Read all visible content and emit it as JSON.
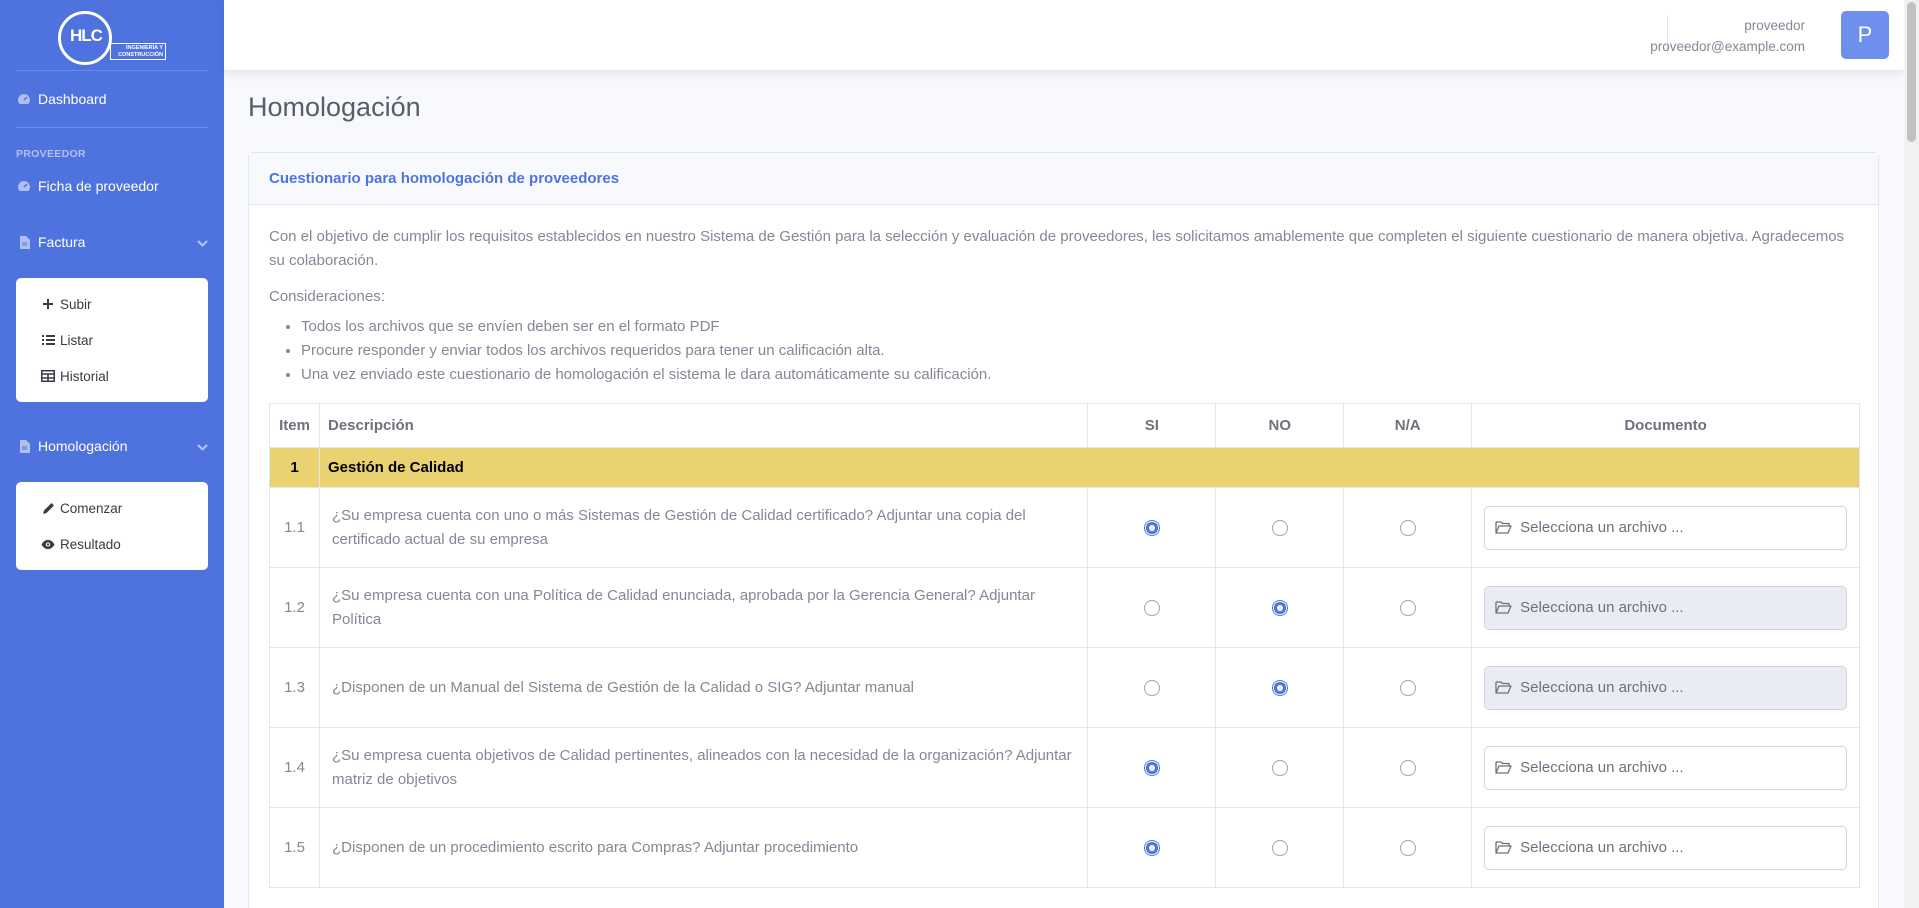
{
  "sidebar": {
    "logo": {
      "initials": "HLC",
      "subtitle_line1": "INGENIERÍA Y",
      "subtitle_line2": "CONSTRUCCIÓN"
    },
    "dashboard": "Dashboard",
    "section_heading": "PROVEEDOR",
    "ficha": "Ficha de proveedor",
    "factura": {
      "label": "Factura",
      "items": [
        "Subir",
        "Listar",
        "Historial"
      ]
    },
    "homologacion": {
      "label": "Homologación",
      "items": [
        "Comenzar",
        "Resultado"
      ]
    }
  },
  "topbar": {
    "user_name": "proveedor",
    "user_email": "proveedor@example.com",
    "avatar_letter": "P"
  },
  "page": {
    "title": "Homologación",
    "card_title": "Cuestionario para homologación de proveedores",
    "intro": "Con el objetivo de cumplir los requisitos establecidos en nuestro Sistema de Gestión para la selección y evaluación de proveedores, les solicitamos amablemente que completen el siguiente cuestionario de manera objetiva. Agradecemos su colaboración.",
    "considerations_label": "Consideraciones:",
    "considerations": [
      "Todos los archivos que se envíen deben ser en el formato PDF",
      "Procure responder y enviar todos los archivos requeridos para tener un calificación alta.",
      "Una vez enviado este cuestionario de homologación el sistema le dara automáticamente su calificación."
    ]
  },
  "table": {
    "headers": [
      "Item",
      "Descripción",
      "SI",
      "NO",
      "N/A",
      "Documento"
    ],
    "group": {
      "number": "1",
      "title": "Gestión de Calidad"
    },
    "file_placeholder": "Selecciona un archivo ...",
    "rows": [
      {
        "item": "1.1",
        "desc": "¿Su empresa cuenta con uno o más Sistemas de Gestión de Calidad certificado? Adjuntar una copia del certificado actual de su empresa",
        "answer": "SI",
        "doc_disabled": false
      },
      {
        "item": "1.2",
        "desc": "¿Su empresa cuenta con una Política de Calidad enunciada, aprobada por la Gerencia General? Adjuntar Política",
        "answer": "NO",
        "doc_disabled": true
      },
      {
        "item": "1.3",
        "desc": "¿Disponen de un Manual del Sistema de Gestión de la Calidad o SIG? Adjuntar manual",
        "answer": "NO",
        "doc_disabled": true
      },
      {
        "item": "1.4",
        "desc": "¿Su empresa cuenta objetivos de Calidad pertinentes, alineados con la necesidad de la organización? Adjuntar matriz de objetivos",
        "answer": "SI",
        "doc_disabled": false
      },
      {
        "item": "1.5",
        "desc": "¿Disponen de un procedimiento escrito para Compras? Adjuntar procedimiento",
        "answer": "SI",
        "doc_disabled": false
      }
    ]
  },
  "colors": {
    "primary": "#4e73df",
    "group_row": "#ead271",
    "avatar": "#6f8fef"
  }
}
